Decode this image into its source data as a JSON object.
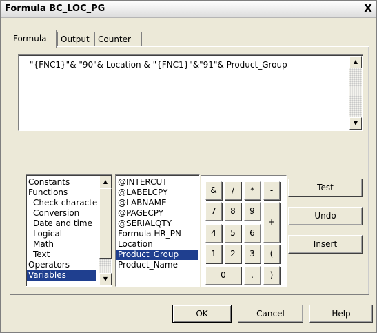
{
  "window": {
    "title": "Formula BC_LOC_PG",
    "close": "X"
  },
  "tabs": [
    "Formula",
    "Output",
    "Counter"
  ],
  "formula": {
    "text": "\"{FNC1}\"& \"90\"& Location & \"{FNC1}\"&\"91\"& Product_Group"
  },
  "categories": {
    "items": [
      "Constants",
      "Functions",
      "Check characte",
      "Conversion",
      "Date and time",
      "Logical",
      "Math",
      "Text",
      "Operators",
      "Variables"
    ],
    "selected": "Variables"
  },
  "variables": {
    "items": [
      "@INTERCUT",
      "@LABELCPY",
      "@LABNAME",
      "@PAGECPY",
      "@SERIALQTY",
      "Formula HR_PN",
      "Location",
      "Product_Group",
      "Product_Name"
    ],
    "selected": "Product_Group"
  },
  "keypad": {
    "row1": [
      "&",
      "/",
      "*",
      "-"
    ],
    "row2": [
      "7",
      "8",
      "9"
    ],
    "row3": [
      "4",
      "5",
      "6"
    ],
    "plus": "+",
    "row4": [
      "1",
      "2",
      "3",
      "("
    ],
    "zero": "0",
    "dot": ".",
    "close_paren": ")"
  },
  "side_buttons": {
    "test": "Test",
    "undo": "Undo",
    "insert": "Insert"
  },
  "footer": {
    "ok": "OK",
    "cancel": "Cancel",
    "help": "Help"
  },
  "scroll_arrows": {
    "up": "▲",
    "down": "▼"
  }
}
